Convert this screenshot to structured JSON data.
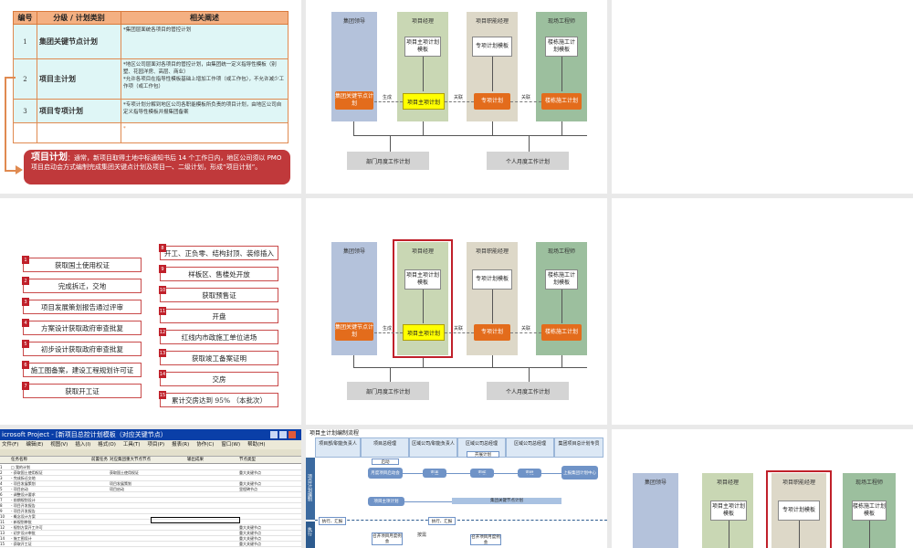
{
  "slide1": {
    "headers": [
      "编号",
      "分级 / 计划类别",
      "相关阐述"
    ],
    "rows": [
      {
        "num": "1",
        "cat": "集团关键节点计划",
        "desc": "*集团层面统各项目的管控计划"
      },
      {
        "num": "2",
        "cat": "项目主计划",
        "desc": "*地区公司层面对各项目的管控计划，由集团统一定义指导性模板（别墅、花园洋房、高层、商业）",
        "desc2": "*允许各项目在指导性模板基础上增加工作项（或工作包），不允许减少工作项（或工作包）"
      },
      {
        "num": "3",
        "cat": "项目专项计划",
        "desc": "*专项计划分解到地区公司各职能模板所负责的项目计划，由地区公司自定义指导性模板并报集团备案"
      }
    ],
    "extra_mark": "*",
    "callout_title": "项目计划",
    "callout_text": "：通常，新项目取得土地中标通知书后 14 个工作日内，地区公司须以 PMO 项目启动会方式编制完成集团关键点计划及项目一、二级计划，形成“项目计划”。"
  },
  "flow": {
    "lanes": [
      "集团领导",
      "项目经理",
      "项目职能经理",
      "现场工程师"
    ],
    "top_boxes": [
      "项目主项计划模板",
      "专项计划模板",
      "楼栋施工计划模板"
    ],
    "bottom_boxes": [
      "集团关键节点计划",
      "项目主项计划",
      "专项计划",
      "楼栋施工计划"
    ],
    "labels": [
      "生成",
      "关联",
      "关联"
    ],
    "outputs": [
      "部门月度工作计划",
      "个人月度工作计划"
    ]
  },
  "slide4": {
    "left": [
      {
        "n": "1",
        "t": "获取国土使用权证"
      },
      {
        "n": "2",
        "t": "完成拆迁，交地"
      },
      {
        "n": "3",
        "t": "项目发展策划报告通过评审"
      },
      {
        "n": "4",
        "t": "方案设计获取政府审查批复"
      },
      {
        "n": "5",
        "t": "初步设计获取政府审查批复"
      },
      {
        "n": "6",
        "t": "施工图备案，建设工程规划许可证"
      },
      {
        "n": "7",
        "t": "获取开工证"
      }
    ],
    "right": [
      {
        "n": "8",
        "t": "开工、正负零、结构封顶、装修插入"
      },
      {
        "n": "9",
        "t": "样板区、售楼处开放"
      },
      {
        "n": "10",
        "t": "获取预售证"
      },
      {
        "n": "11",
        "t": "开盘"
      },
      {
        "n": "12",
        "t": "红线内市政施工单位进场"
      },
      {
        "n": "13",
        "t": "获取竣工备案证明"
      },
      {
        "n": "14",
        "t": "交房"
      },
      {
        "n": "15",
        "t": "累计交房达到 95% （本批次）"
      }
    ]
  },
  "msproject": {
    "title": "icrosoft Project - [新项目总控计划模板（对应关键节点）",
    "menu": [
      "文件(F)",
      "编辑(E)",
      "视图(V)",
      "插入(I)",
      "格式(O)",
      "工具(T)",
      "项目(P)",
      "报表(R)",
      "协作(C)",
      "窗口(W)",
      "帮助(H)"
    ],
    "columns": [
      "任务名称",
      "前置任务",
      "对应集团重大节点节点",
      "输出成果",
      "节点类型"
    ],
    "rows": [
      {
        "name": "□ 我的计划",
        "a": "",
        "b": "",
        "c": ""
      },
      {
        "name": "  - 获取国土使用权证",
        "a": "获取国土使用权证",
        "b": "重大关键节点",
        "c": ""
      },
      {
        "name": "  - 完成拆迁交地",
        "a": "",
        "b": "",
        "c": ""
      },
      {
        "name": "  - 项目发展策划",
        "a": "项目发展策划",
        "b": "重大关键节点",
        "c": ""
      },
      {
        "name": "  - 项目启动",
        "a": "项目启动",
        "b": "里程碑节点",
        "c": ""
      },
      {
        "name": "  - 调整设计要求",
        "a": "",
        "b": "",
        "c": ""
      },
      {
        "name": "  - 前期规划设计",
        "a": "",
        "b": "",
        "c": ""
      },
      {
        "name": "  - 项目开发报告",
        "a": "",
        "b": "",
        "c": ""
      },
      {
        "name": "  - 项目开发报告",
        "a": "",
        "b": "",
        "c": ""
      },
      {
        "name": "  - 概念设计方案",
        "a": "",
        "b": "",
        "c": ""
      },
      {
        "name": "  - 新规划审批",
        "a": "",
        "b": "",
        "c": ""
      },
      {
        "name": "  - 规划方案开工许可",
        "a": "",
        "b": "重大关键节点",
        "c": ""
      },
      {
        "name": "  - 初步设计审批",
        "a": "",
        "b": "重大关键节点",
        "c": ""
      },
      {
        "name": "  - 施工图设计",
        "a": "",
        "b": "重大关键节点",
        "c": ""
      },
      {
        "name": "  - 获取开工证",
        "a": "",
        "b": "重大关键节点",
        "c": ""
      }
    ]
  },
  "process": {
    "title": "项目主计划编制流程",
    "cols": [
      "项目部/职能负责人",
      "项目总经理",
      "区域公司/职能负责人",
      "区域公司总经理",
      "区域公司总经理",
      "集团项目总计划专员"
    ],
    "side": [
      "项目计划编制",
      "执行"
    ],
    "labels": [
      "启动",
      "月度项目启动会",
      "审查",
      "审核",
      "审批",
      "上报集团计划中心",
      "开展计划",
      "项目主项计划",
      "集团关键节点计划",
      "执行、汇报",
      "执行、汇报",
      "召开项目月度例会",
      "召开项目月度例会",
      "按需"
    ]
  }
}
